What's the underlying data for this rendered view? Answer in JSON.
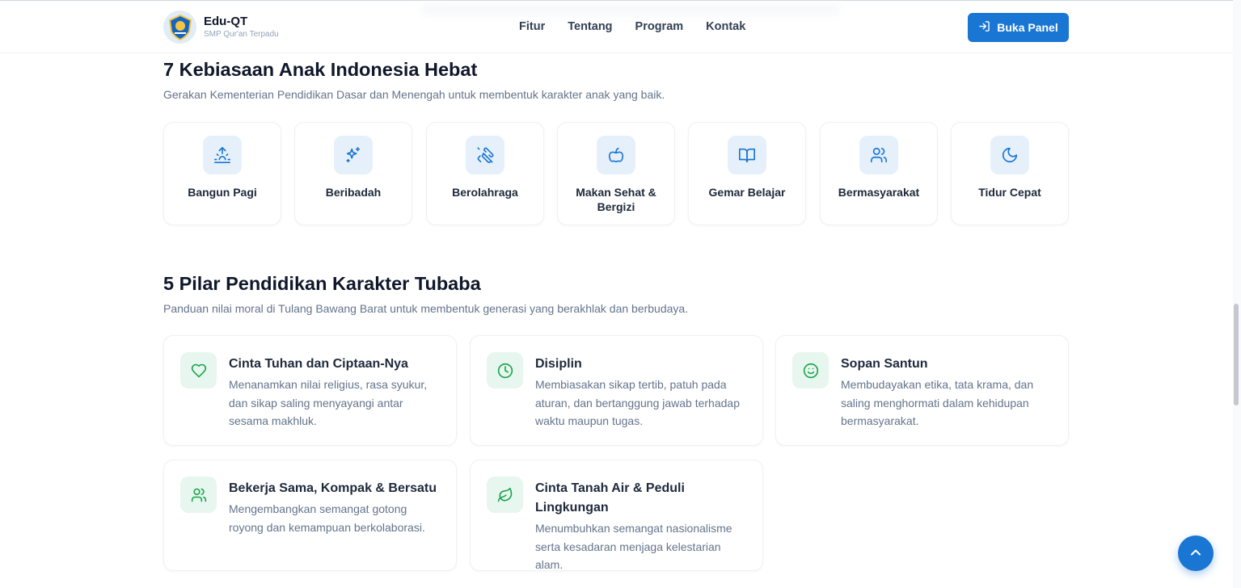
{
  "header": {
    "brand_name": "Edu-QT",
    "brand_subtitle": "SMP Qur'an Terpadu",
    "nav": [
      "Fitur",
      "Tentang",
      "Program",
      "Kontak"
    ],
    "panel_button": "Buka Panel",
    "panel_button_icon": "login-icon",
    "accent_color": "#1976d2"
  },
  "habits": {
    "title": "7 Kebiasaan Anak Indonesia Hebat",
    "subtitle": "Gerakan Kementerian Pendidikan Dasar dan Menengah untuk membentuk karakter anak yang baik.",
    "items": [
      {
        "label": "Bangun Pagi",
        "icon": "sunrise-icon"
      },
      {
        "label": "Beribadah",
        "icon": "sparkles-icon"
      },
      {
        "label": "Berolahraga",
        "icon": "dumbbell-icon"
      },
      {
        "label": "Makan Sehat & Bergizi",
        "icon": "apple-icon"
      },
      {
        "label": "Gemar Belajar",
        "icon": "book-open-icon"
      },
      {
        "label": "Bermasyarakat",
        "icon": "users-icon"
      },
      {
        "label": "Tidur Cepat",
        "icon": "moon-icon"
      }
    ]
  },
  "pillars": {
    "title": "5 Pilar Pendidikan Karakter Tubaba",
    "subtitle": "Panduan nilai moral di Tulang Bawang Barat untuk membentuk generasi yang berakhlak dan berbudaya.",
    "items": [
      {
        "title": "Cinta Tuhan dan Ciptaan-Nya",
        "desc": "Menanamkan nilai religius, rasa syukur, dan sikap saling menyayangi antar sesama makhluk.",
        "icon": "heart-icon"
      },
      {
        "title": "Disiplin",
        "desc": "Membiasakan sikap tertib, patuh pada aturan, dan bertanggung jawab terhadap waktu maupun tugas.",
        "icon": "clock-icon"
      },
      {
        "title": "Sopan Santun",
        "desc": "Membudayakan etika, tata krama, dan saling menghormati dalam kehidupan bermasyarakat.",
        "icon": "smile-icon"
      },
      {
        "title": "Bekerja Sama, Kompak & Bersatu",
        "desc": "Mengembangkan semangat gotong royong dan kemampuan berkolaborasi.",
        "icon": "users-icon"
      },
      {
        "title": "Cinta Tanah Air & Peduli Lingkungan",
        "desc": "Menumbuhkan semangat nasionalisme serta kesadaran menjaga kelestarian alam.",
        "icon": "leaf-icon"
      }
    ]
  },
  "scroll_to_top_icon": "chevron-up-icon"
}
